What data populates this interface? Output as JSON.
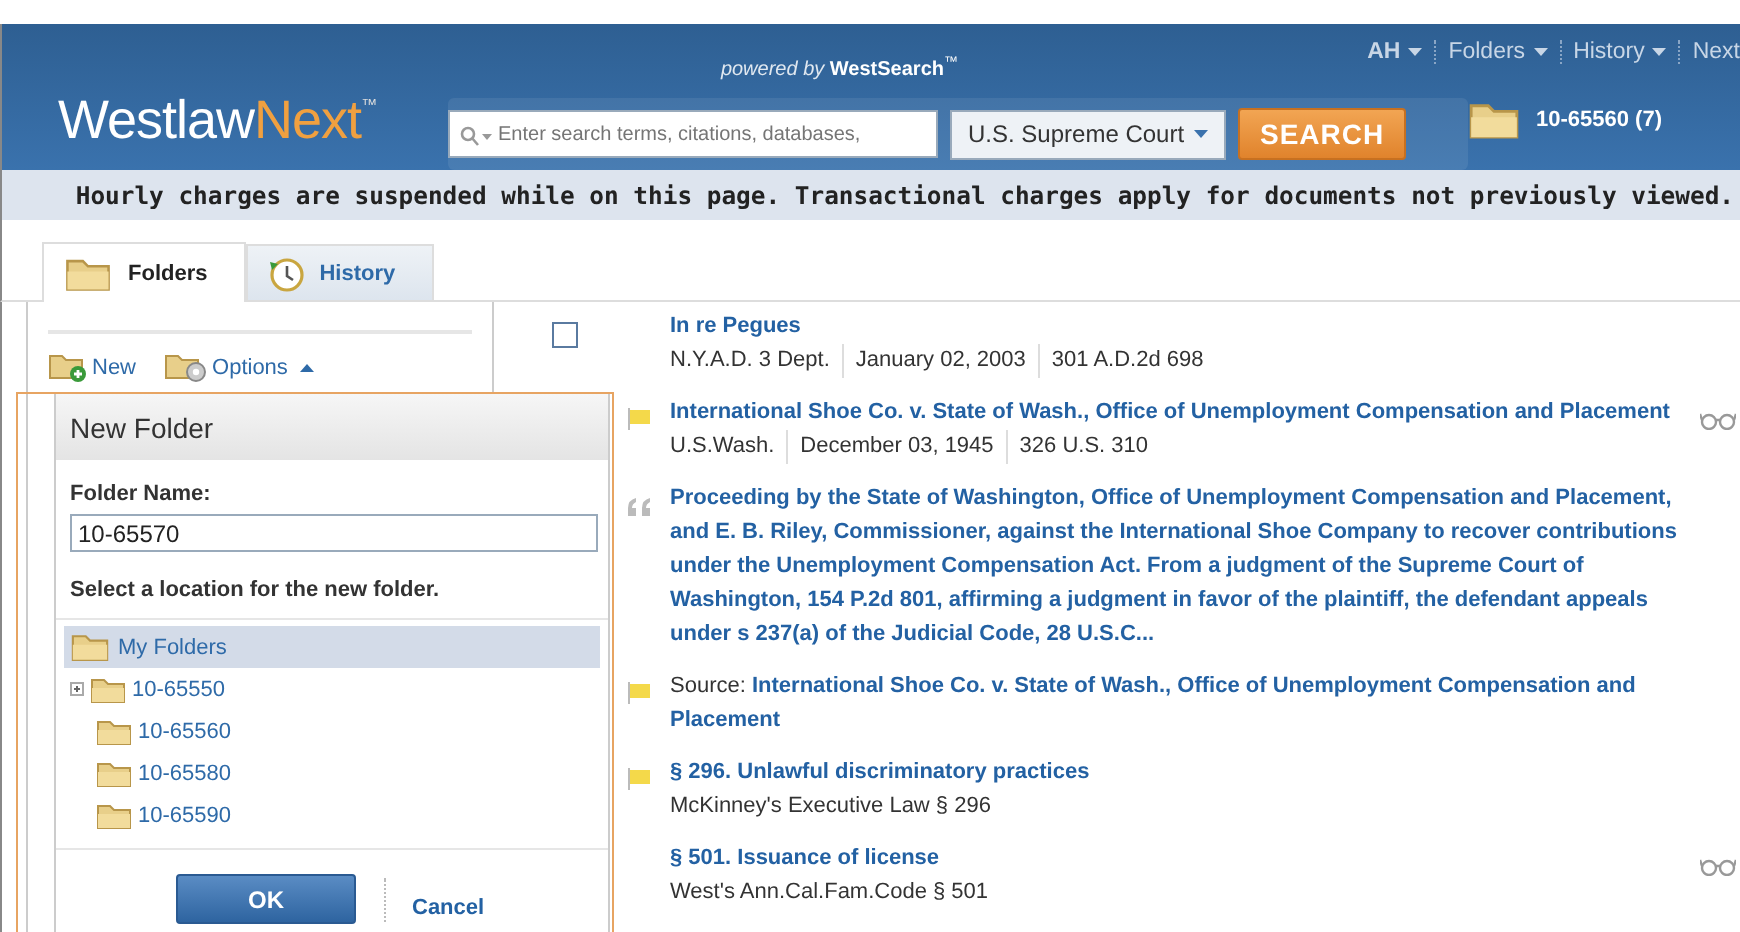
{
  "header": {
    "powered_by": "powered by",
    "brand_search": "WestSearch",
    "tm": "™",
    "logo_main": "Westlaw",
    "logo_accent": "Next",
    "logo_tm": "™",
    "search": {
      "placeholder": "Enter search terms, citations, databases,"
    },
    "jurisdiction": "U.S. Supreme Court",
    "search_button": "SEARCH",
    "nav": [
      {
        "label": "AH",
        "caret": true
      },
      {
        "label": "Folders",
        "caret": true
      },
      {
        "label": "History",
        "caret": true
      },
      {
        "label": "Next",
        "caret": false
      }
    ],
    "current_folder": "10-65560 (7)"
  },
  "notice": "Hourly charges are suspended while on this page. Transactional charges apply for documents not previously viewed.",
  "tabs": [
    {
      "label": "Folders",
      "selected": true,
      "kind": "folders"
    },
    {
      "label": "History",
      "selected": false,
      "kind": "history"
    }
  ],
  "toolbar": [
    {
      "label": "New",
      "kind": "new"
    },
    {
      "label": "Options",
      "kind": "options"
    }
  ],
  "dialog": {
    "title": "New Folder",
    "name_label": "Folder Name:",
    "name_value": "10-65570",
    "location_label": "Select a location for the new folder.",
    "tree": [
      {
        "label": "My Folders",
        "selected": true,
        "children": [
          {
            "label": "10-65550",
            "selected": false,
            "expandable": true
          },
          {
            "label": "10-65560",
            "selected": false,
            "expandable": false
          },
          {
            "label": "10-65580",
            "selected": false,
            "expandable": false
          },
          {
            "label": "10-65590",
            "selected": false,
            "expandable": false
          }
        ]
      }
    ],
    "ok": "OK",
    "cancel": "Cancel"
  },
  "results": [
    {
      "kind": "checkbox",
      "checked": false,
      "title": "In re Pegues",
      "meta": [
        "N.Y.A.D. 3 Dept.",
        "January 02, 2003",
        "301 A.D.2d 698"
      ],
      "viewed": false
    },
    {
      "kind": "flag",
      "title": "International Shoe Co. v. State of Wash., Office of Unemployment Compensation and Placement",
      "meta": [
        "U.S.Wash.",
        "December 03, 1945",
        "326 U.S. 310"
      ],
      "viewed": true
    },
    {
      "kind": "quote",
      "title": "Proceeding by the State of Washington, Office of Unemployment Compensation and Placement, and E. B. Riley, Commissioner, against the International Shoe Company to recover contributions under the Unemployment Compensation Act. From a judgment of the Supreme Court of Washington, 154 P.2d 801, affirming a judgment in favor of the plaintiff, the defendant appeals under s 237(a) of the Judicial Code, 28 U.S.C...",
      "viewed": false
    },
    {
      "kind": "flag",
      "source_label": "Source:",
      "title": "International Shoe Co. v. State of Wash., Office of Unemployment Compensation and Placement",
      "viewed": false
    },
    {
      "kind": "flag",
      "title": "§ 296. Unlawful discriminatory practices",
      "meta": [
        "McKinney's Executive Law §  296"
      ],
      "viewed": false
    },
    {
      "kind": "none",
      "title": "§ 501. Issuance of license",
      "meta": [
        "West's Ann.Cal.Fam.Code §  501"
      ],
      "viewed": true
    }
  ]
}
